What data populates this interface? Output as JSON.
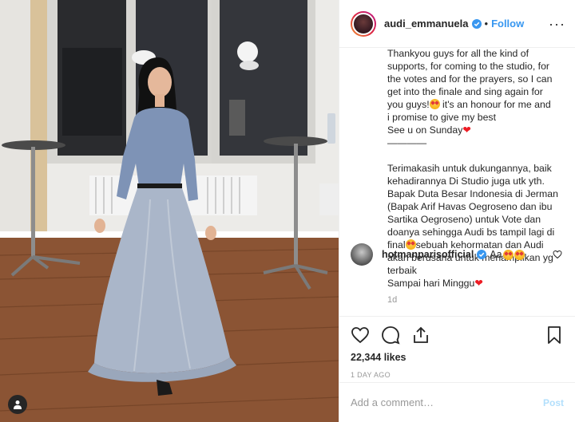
{
  "post": {
    "username": "audi_emmanuela",
    "verified_icon": "verified-badge-icon",
    "separator": "•",
    "follow_label": "Follow",
    "more_label": "···",
    "caption_lines": [
      "Thankyou guys for all the kind of",
      "supports, for coming to the studio, for",
      "the votes and for the prayers, so I can",
      "get into the finale and sing again for",
      "you guys!",
      " it's an honour for me and",
      "i promise to give my best",
      "See u on Sunday",
      "————",
      "Terimakasih untuk dukungannya, baik",
      "kehadirannya Di Studio juga utk yth.",
      "Bapak Duta Besar Indonesia di Jerman",
      "(Bapak Arif Havas Oegroseno dan ibu",
      "Sartika Oegroseno) untuk Vote dan",
      "doanya sehingga Audi bs tampil lagi di",
      "final",
      "sebuah kehormatan dan Audi",
      "akan berusaha untuk menampilkan yg",
      "terbaik",
      "Sampai hari Minggu"
    ],
    "caption_time": "1d"
  },
  "comment": {
    "username": "hotmanparisofficial",
    "text": "Aa"
  },
  "actions": {
    "likes": "22,344 likes",
    "timestamp": "1 DAY AGO"
  },
  "add_comment": {
    "placeholder": "Add a comment…",
    "post_label": "Post"
  },
  "colors": {
    "accent": "#3897f0",
    "post_disabled": "#b2dffc",
    "heart": "#ed1c24"
  }
}
